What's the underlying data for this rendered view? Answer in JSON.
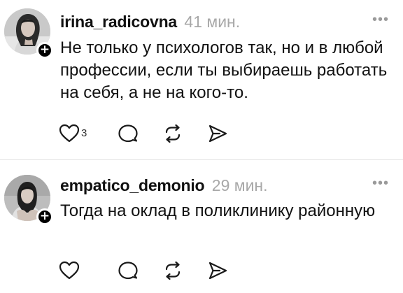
{
  "posts": [
    {
      "username": "irina_radicovna",
      "timestamp": "41 мин.",
      "more_label": "•••",
      "follow_label": "+",
      "text": "Не только у психологов так, но и в любой профессии, если ты выбираешь работать на себя, а не на кого-то.",
      "likes": "3",
      "icons": [
        "heart-icon",
        "comment-icon",
        "repost-icon",
        "share-icon"
      ]
    },
    {
      "username": "empatico_demonio",
      "timestamp": "29 мин.",
      "more_label": "•••",
      "follow_label": "+",
      "text": "Тогда на оклад в поликлинику районную",
      "likes": "",
      "icons": [
        "heart-icon",
        "comment-icon",
        "repost-icon",
        "share-icon"
      ]
    }
  ],
  "colors": {
    "text": "#111111",
    "timestamp": "#a8a8a8",
    "divider": "#e3e3e3",
    "icon": "#1a1a1a"
  }
}
